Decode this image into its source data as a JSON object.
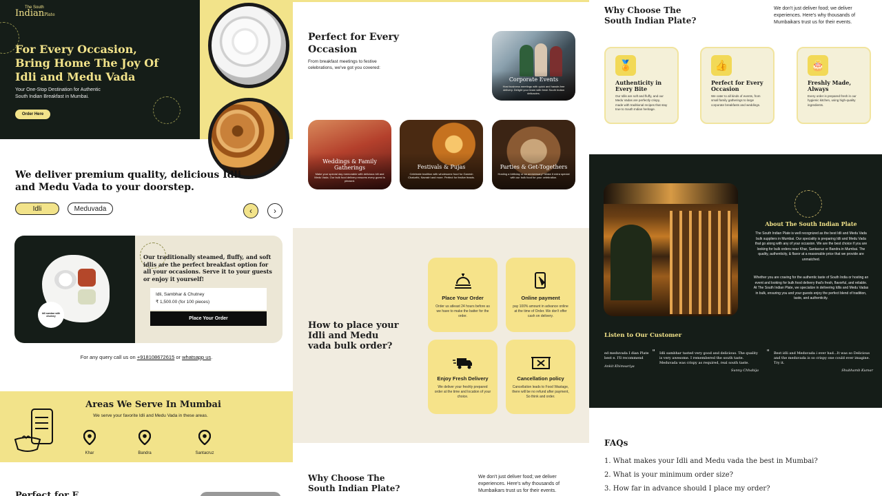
{
  "col1": {
    "hero": {
      "logo_top": "The",
      "logo_south": "South",
      "logo_main": "Indian",
      "logo_sub": "Plate",
      "heading_line1": "For Every Occasion,",
      "heading_line2": "Bring Home The Joy Of",
      "heading_line3": "Idli and Medu Vada",
      "subtext_line1": "Your One-Stop Destination for Authentic",
      "subtext_line2": "South Indian Breakfast in Mumbai.",
      "cta": "Order Here"
    },
    "deliver": {
      "heading_line1": "We deliver premium quality, delicious Idli",
      "heading_line2": "and Medu Vada to your doorstep.",
      "tab_idli": "Idli",
      "tab_meduvada": "Meduvada",
      "prev": "‹",
      "next": "›"
    },
    "product": {
      "badge": "Idli sambar with chutney",
      "desc": "Our traditionally steamed, fluffy, and soft idlis are the perfect breakfast option for all your occasions. Serve it to your guests or enjoy it yourself!",
      "item_name": "Idli, Sambhar & Chutney",
      "item_price": "₹ 1,500.00 (for 100 pieces)",
      "order_button": "Place Your Order"
    },
    "query": {
      "prefix": "For any query call us on",
      "phone": "+918108672615",
      "mid": "or",
      "whatsapp": "whatsapp us",
      "suffix": "."
    },
    "areas": {
      "title": "Areas We Serve In Mumbai",
      "subtitle": "We serve your favorite Idli and Medu Vada in these areas.",
      "locations": [
        "Khar",
        "Bandra",
        "Santacruz"
      ]
    },
    "bottom_peek": "Perfect for E..."
  },
  "col2": {
    "perfect": {
      "title_line1": "Perfect for Every",
      "title_line2": "Occasion",
      "subtitle": "From breakfast meetings to festive celebrations, we've got you covered:",
      "corporate_title": "Corporate Events",
      "corporate_desc": "Host business meetings with quick and hassle-free delivery. Delight your team with fresh South Indian delicacies.",
      "cards": [
        {
          "title": "Weddings & Family Gatherings",
          "desc": "Make your special day memorable with delicious Idli and Medu Vada. Our bulk food delivery ensures every guest is pleased."
        },
        {
          "title": "Festivals & Pujas",
          "desc": "Celebrate tradition with wholesome food for Ganesh Chaturthi, Navratri and more. Perfect for festive feasts."
        },
        {
          "title": "Parties & Get-Togethers",
          "desc": "Hosting a birthday or an anniversary? Make it extra special with our bulk food for your celebration."
        }
      ]
    },
    "howto": {
      "title_line1": "How to place your",
      "title_line2": "Idli and Medu",
      "title_line3": "vada bulk order?",
      "steps": [
        {
          "title": "Place Your Order",
          "desc": "Order us atleast 24 hours before as we have to make the batter for the order."
        },
        {
          "title": "Online payment",
          "desc": "pay 100% amount in advance online at the time of Order. We don't offer cash on delivery."
        },
        {
          "title": "Enjoy Fresh Delivery",
          "desc": "We deliver your freshly prepared order at the time and location of your choice."
        },
        {
          "title": "Cancellation policy",
          "desc": "Cancellation leads to Food Wastage, there will be no refund after payment, So think and order."
        }
      ]
    },
    "why_peek": {
      "title_line1": "Why Choose The",
      "title_line2": "South Indian Plate?",
      "desc": "We don't just deliver food; we deliver experiences. Here's why thousands of Mumbaikars trust us for their events."
    }
  },
  "col3": {
    "why": {
      "title_line1": "Why Choose The",
      "title_line2": "South Indian Plate?",
      "desc": "We don't just deliver food; we deliver experiences. Here's why thousands of Mumbaikars trust us for their events.",
      "cards": [
        {
          "icon": "award-icon",
          "glyph": "🏅",
          "title": "Authenticity in Every Bite",
          "desc": "Our Idlis are soft and fluffy, and our Medu Vadas are perfectly crispy, made with traditional recipes that stay true to South Indian heritage."
        },
        {
          "icon": "thumbs-up-icon",
          "glyph": "👍",
          "title": "Perfect for Every Occasion",
          "desc": "We cater to all kinds of events, from small family gatherings to large corporate breakfasts and weddings."
        },
        {
          "icon": "cake-icon",
          "glyph": "🎂",
          "title": "Freshly Made, Always",
          "desc": "Every order is prepared fresh in our hygienic kitchen, using high-quality ingredients."
        }
      ]
    },
    "about": {
      "title": "About The South Indian Plate",
      "para1": "The South Indian Plate is well recognized as the best Idli and Medu Vada bulk suppliers in Mumbai. Our speciality is preparing Idli and Medu Vada that go along with any of your occasion. We are the best choice if you are looking for bulk orders near Khar, Santacruz or Bandra in Mumbai. The quality, authenticity, & flavor at a reasonable price that we provide are unmatched.",
      "para2": "Whether you are craving for the authentic taste of South India or hosting an event and looking for bulk food delivery that's fresh, flavorful, and reliable. At The South Indian Plate, we specialize in delivering Idlis and Medu Vadas in bulk, ensuring you and your guests enjoy the perfect blend of tradition, taste, and authenticity."
    },
    "testimonials": {
      "title": "Listen to Our Customer",
      "items": [
        {
          "text": "ed meduvada I dian Plate best e. I'll recommend",
          "name": "Ankit Khimsariya"
        },
        {
          "text": "Idli sambhar tasted very good and delicious. The quality is very awesome. I remembered the south taste. Meduvada was crispy as required, real south taste.",
          "name": "Sunny Chhabija"
        },
        {
          "text": "Best idli and Meduvada i ever had...It was so Delicious and the meduvada is so crispy one could ever imagine. Try it.",
          "name": "Shubhamb Kumar"
        }
      ]
    },
    "faq": {
      "title": "FAQs",
      "items": [
        "1. What makes your Idli and Medu vada the best in Mumbai?",
        "2. What is your minimum order size?",
        "3. How far in advance should I place my order?"
      ]
    }
  }
}
